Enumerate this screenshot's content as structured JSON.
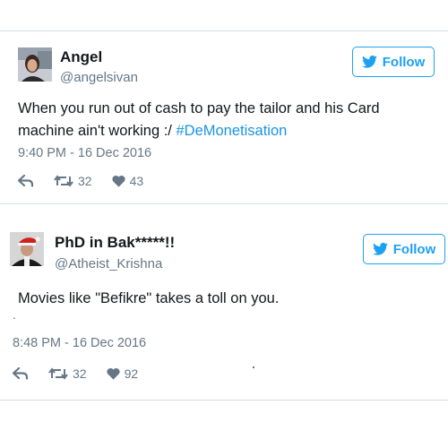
{
  "tweets": [
    {
      "name": "Angel",
      "handle": "@angelsivan",
      "follow_label": "Follow",
      "text": "When you run out of cash to pay the tailor and his Card machine ain't working :/ ",
      "hashtag": "#DeMonetisation",
      "time": "9:40 PM - 16 Dec 2016",
      "retweets": "32",
      "likes": "43"
    },
    {
      "name": "PhD in Bak*****!!",
      "handle": "@Atheist_Krishna",
      "follow_label": "Follow",
      "text": "Movies like \"Befikre\" takes a toll on you.",
      "text_extra": ".",
      "time": "8:48 PM - 16 Dec 2016",
      "retweets": "32",
      "likes": "92"
    }
  ],
  "colors": {
    "accent": "#1da1f2",
    "hashtag": "#1b95e0",
    "muted": "#657786",
    "like_icon": "#657786"
  },
  "icons": [
    "twitter-bird-icon",
    "reply-icon",
    "retweet-icon",
    "heart-icon"
  ]
}
